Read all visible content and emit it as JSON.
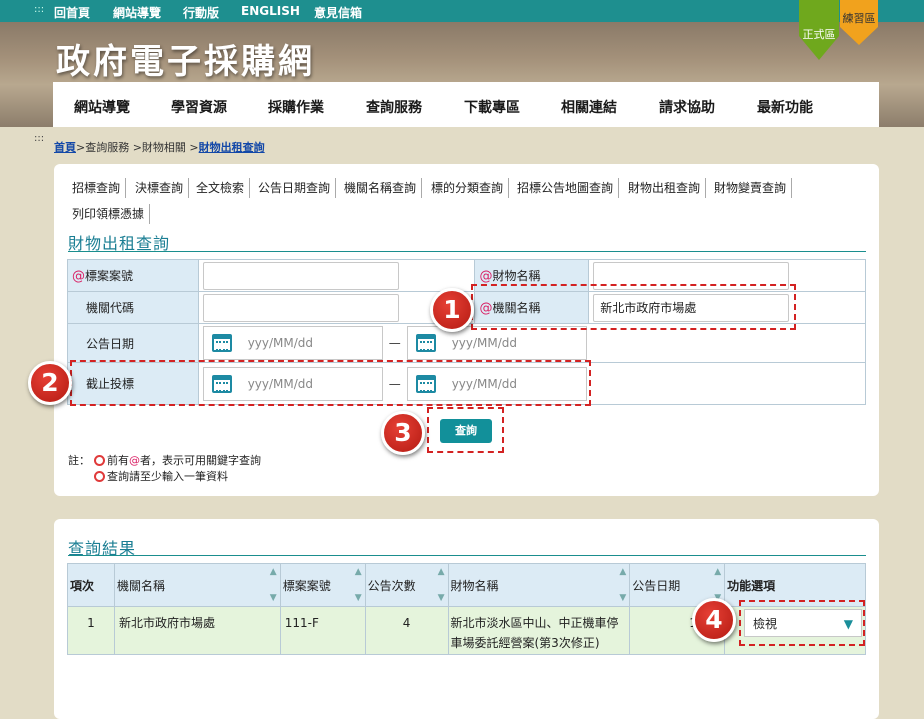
{
  "topbar": {
    "dots": ":::",
    "links": [
      "回首頁",
      "網站導覽",
      "行動版",
      "ENGLISH",
      "意見信箱"
    ]
  },
  "banner": {
    "title": "政府電子採購網",
    "zone_real": "正式區",
    "zone_practice": "練習區"
  },
  "nav": [
    "網站導覽",
    "學習資源",
    "採購作業",
    "查詢服務",
    "下載專區",
    "相關連結",
    "請求協助",
    "最新功能"
  ],
  "breadcrumb": {
    "dots": ":::",
    "home": "首頁",
    "mid": ">查詢服務 >財物相關 >",
    "current": "財物出租查詢"
  },
  "tabs": [
    "招標查詢",
    "決標查詢",
    "全文檢索",
    "公告日期查詢",
    "機關名稱查詢",
    "標的分類查詢",
    "招標公告地圖查詢",
    "財物出租查詢",
    "財物變賣查詢",
    "列印領標憑據"
  ],
  "form": {
    "title": "財物出租查詢",
    "at": "@",
    "case_no_label": "標案案號",
    "case_no_value": "",
    "item_name_label": "財物名稱",
    "item_name_value": "",
    "org_code_label": "機關代碼",
    "org_code_value": "",
    "org_name_label": "機關名稱",
    "org_name_value": "新北市政府市場處",
    "pub_date_label": "公告日期",
    "deadline_label": "截止投標",
    "date_placeholder": "yyy/MM/dd",
    "date_sep": "—",
    "search_button": "查詢"
  },
  "notes": {
    "prefix": "註：",
    "line1_a": "前有",
    "line1_at": "@",
    "line1_b": "者，表示可用關鍵字查詢",
    "line2": "查詢請至少輸入一筆資料"
  },
  "badges": [
    "1",
    "2",
    "3",
    "4"
  ],
  "results": {
    "title": "查詢結果",
    "headers": [
      "項次",
      "機關名稱",
      "標案案號",
      "公告次數",
      "財物名稱",
      "公告日期",
      "功能選項"
    ],
    "rows": [
      {
        "index": "1",
        "org": "新北市政府市場處",
        "case_no": "111-F",
        "count": "4",
        "item": "新北市淡水區中山、中正機車停車場委託經營案(第3次修正)",
        "date": "111/"
      }
    ],
    "action_selected": "檢視"
  },
  "colors": {
    "accent": "#1e8f8f",
    "highlight_red": "#d32222",
    "label_bg": "#dcebf5",
    "row_bg": "#e5f4dc"
  }
}
